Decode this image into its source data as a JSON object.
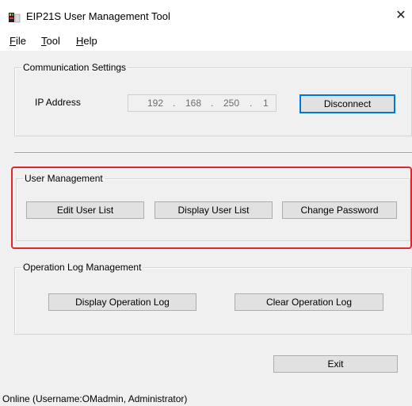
{
  "window": {
    "title": "EIP21S User Management Tool",
    "close_glyph": "✕",
    "icon": "app-icon"
  },
  "menu": {
    "items": [
      {
        "accel": "F",
        "rest": "ile"
      },
      {
        "accel": "T",
        "rest": "ool"
      },
      {
        "accel": "H",
        "rest": "elp"
      }
    ]
  },
  "communication": {
    "legend": "Communication Settings",
    "ip_label": "IP Address",
    "ip_octets": [
      "192",
      "168",
      "250",
      "1"
    ],
    "disconnect_label": "Disconnect"
  },
  "user_management": {
    "legend": "User Management",
    "edit_label": "Edit User List",
    "display_label": "Display User List",
    "change_password_label": "Change Password",
    "highlight_color": "#e0252c"
  },
  "operation_log": {
    "legend": "Operation Log Management",
    "display_label": "Display Operation Log",
    "clear_label": "Clear Operation Log"
  },
  "exit_label": "Exit",
  "status": {
    "text": "Online (Username:OMadmin, Administrator)"
  },
  "colors": {
    "accent": "#0078d7",
    "button_face": "#e1e1e1"
  }
}
